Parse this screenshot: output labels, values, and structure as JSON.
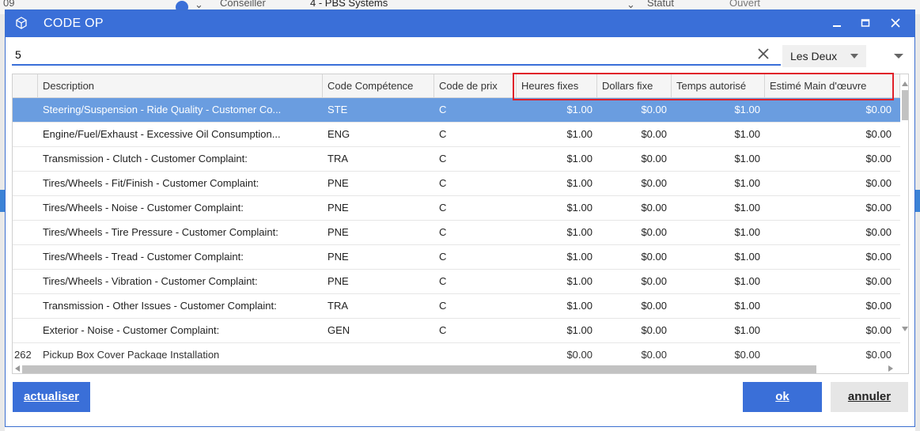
{
  "background": {
    "row_number": "09",
    "conseiller_label": "Conseiller",
    "conseiller_value": "4 - PBS Systems",
    "statut_label": "Statut",
    "statut_value": "Ouvert"
  },
  "dialog": {
    "title": "CODE OP",
    "icon": "cube-icon",
    "controls": {
      "minimize": "minimize-icon",
      "maximize": "maximize-icon",
      "close": "close-icon"
    }
  },
  "search": {
    "value": "5",
    "clear_icon": "close-icon",
    "mode_value": "Les Deux"
  },
  "table": {
    "columns": [
      "Description",
      "Code Compétence",
      "Code de prix",
      "Heures fixes",
      "Dollars fixe",
      "Temps autorisé",
      "Estimé Main d'œuvre"
    ],
    "rows": [
      {
        "description": "Steering/Suspension - Ride Quality - Customer Co...",
        "skill": "STE",
        "price_code": "C",
        "hours": "$1.00",
        "dollars": "$0.00",
        "time": "$1.00",
        "estimate": "$0.00"
      },
      {
        "description": "Engine/Fuel/Exhaust - Excessive Oil Consumption...",
        "skill": "ENG",
        "price_code": "C",
        "hours": "$1.00",
        "dollars": "$0.00",
        "time": "$1.00",
        "estimate": "$0.00"
      },
      {
        "description": "Transmission - Clutch - Customer Complaint:",
        "skill": "TRA",
        "price_code": "C",
        "hours": "$1.00",
        "dollars": "$0.00",
        "time": "$1.00",
        "estimate": "$0.00"
      },
      {
        "description": "Tires/Wheels - Fit/Finish - Customer Complaint:",
        "skill": "PNE",
        "price_code": "C",
        "hours": "$1.00",
        "dollars": "$0.00",
        "time": "$1.00",
        "estimate": "$0.00"
      },
      {
        "description": "Tires/Wheels - Noise - Customer Complaint:",
        "skill": "PNE",
        "price_code": "C",
        "hours": "$1.00",
        "dollars": "$0.00",
        "time": "$1.00",
        "estimate": "$0.00"
      },
      {
        "description": "Tires/Wheels - Tire Pressure - Customer Complaint:",
        "skill": "PNE",
        "price_code": "C",
        "hours": "$1.00",
        "dollars": "$0.00",
        "time": "$1.00",
        "estimate": "$0.00"
      },
      {
        "description": "Tires/Wheels - Tread - Customer Complaint:",
        "skill": "PNE",
        "price_code": "C",
        "hours": "$1.00",
        "dollars": "$0.00",
        "time": "$1.00",
        "estimate": "$0.00"
      },
      {
        "description": "Tires/Wheels - Vibration - Customer Complaint:",
        "skill": "PNE",
        "price_code": "C",
        "hours": "$1.00",
        "dollars": "$0.00",
        "time": "$1.00",
        "estimate": "$0.00"
      },
      {
        "description": "Transmission - Other Issues - Customer Complaint:",
        "skill": "TRA",
        "price_code": "C",
        "hours": "$1.00",
        "dollars": "$0.00",
        "time": "$1.00",
        "estimate": "$0.00"
      },
      {
        "description": "Exterior - Noise - Customer Complaint:",
        "skill": "GEN",
        "price_code": "C",
        "hours": "$1.00",
        "dollars": "$0.00",
        "time": "$1.00",
        "estimate": "$0.00"
      }
    ],
    "partial_row": {
      "code": "262",
      "description": "Pickup Box Cover Package Installation",
      "hours": "$0.00",
      "dollars": "$0.00",
      "time": "$0.00",
      "estimate": "$0.00"
    }
  },
  "buttons": {
    "refresh": "actualiser",
    "ok": "ok",
    "cancel": "annuler"
  },
  "colors": {
    "accent": "#3a6fd8",
    "selection": "#6a9de0",
    "highlight": "#e0202a"
  }
}
